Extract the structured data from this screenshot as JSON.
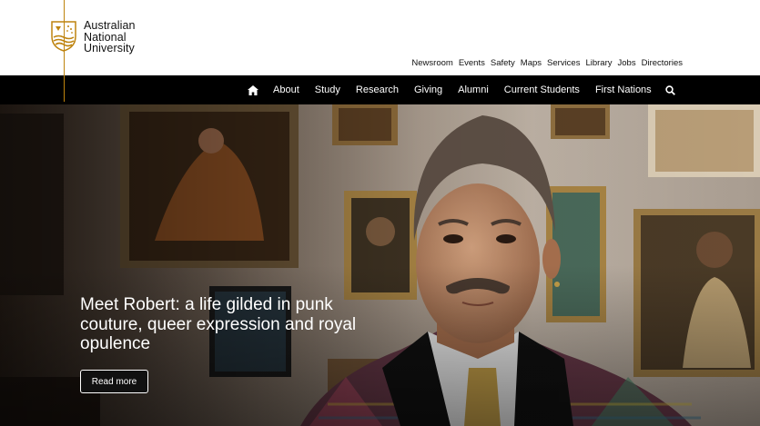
{
  "brand": {
    "line1": "Australian",
    "line2": "National",
    "line3": "University",
    "accent": "#be830e"
  },
  "utility_nav": [
    "Newsroom",
    "Events",
    "Safety",
    "Maps",
    "Services",
    "Library",
    "Jobs",
    "Directories"
  ],
  "main_nav": {
    "home_icon": "home-icon",
    "items": [
      "About",
      "Study",
      "Research",
      "Giving",
      "Alumni",
      "Current Students",
      "First Nations"
    ],
    "search_icon": "search-icon"
  },
  "hero": {
    "title": "Meet Robert: a life gilded in punk couture, queer expression and royal opulence",
    "cta": "Read more"
  }
}
